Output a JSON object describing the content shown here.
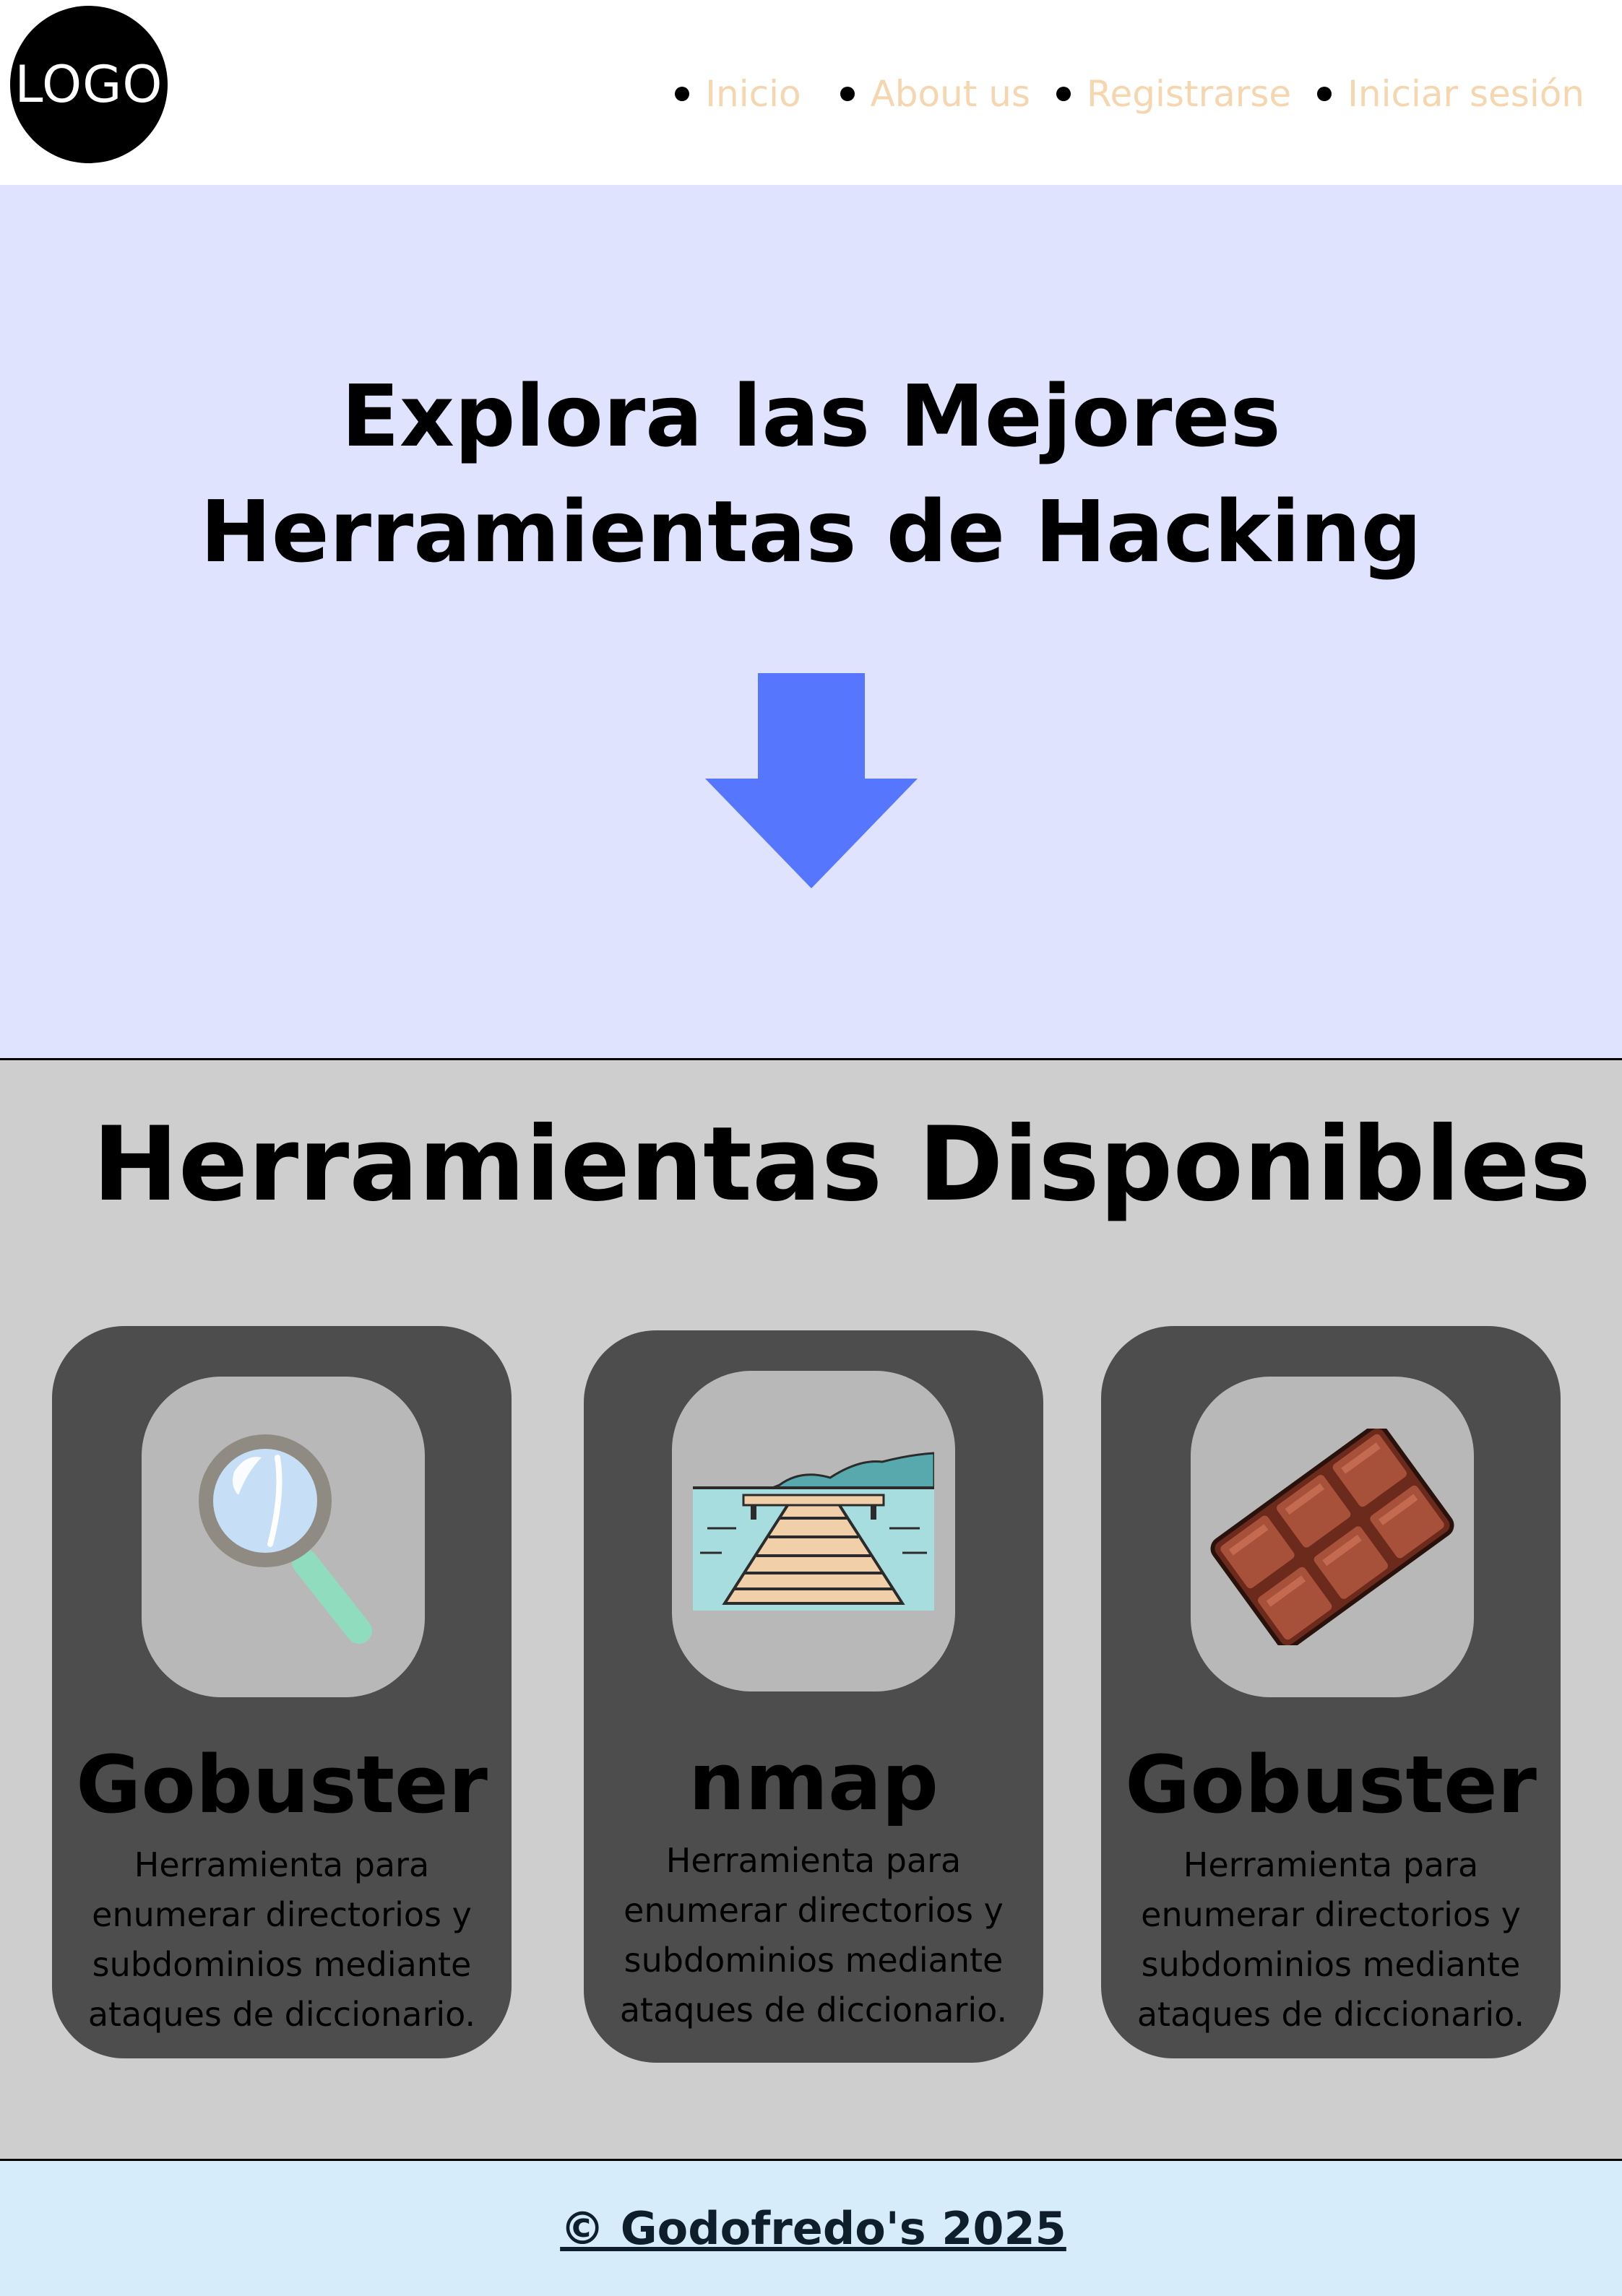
{
  "header": {
    "logo_text": "LOGO",
    "nav": [
      {
        "label": "Inicio",
        "icon": "bullet-icon"
      },
      {
        "label": "About us",
        "icon": "bullet-icon"
      },
      {
        "label": "Registrarse",
        "icon": "bullet-icon"
      },
      {
        "label": "Iniciar sesión",
        "icon": "bullet-icon"
      }
    ],
    "nav_color": "#f5d6ae"
  },
  "hero": {
    "title": "Explora las Mejores Herramientas de Hacking",
    "background": "#e0e3fd",
    "arrow_icon": "arrow-down-icon",
    "arrow_color": "#5676fd"
  },
  "tools": {
    "title": "Herramientas Disponibles",
    "background": "#cecece",
    "cards": [
      {
        "name": "Gobuster",
        "description": "Herramienta para enumerar directorios y subdominios mediante ataques de diccionario.",
        "icon": "magnifying-glass-icon"
      },
      {
        "name": "nmap",
        "description": "Herramienta para enumerar directorios y subdominios mediante ataques de diccionario.",
        "icon": "pier-landscape-icon"
      },
      {
        "name": "Gobuster",
        "description": "Herramienta para enumerar directorios y subdominios mediante ataques de diccionario.",
        "icon": "chocolate-bar-icon"
      }
    ]
  },
  "footer": {
    "text": "© Godofredo's 2025",
    "background": "#d6ecfb"
  }
}
